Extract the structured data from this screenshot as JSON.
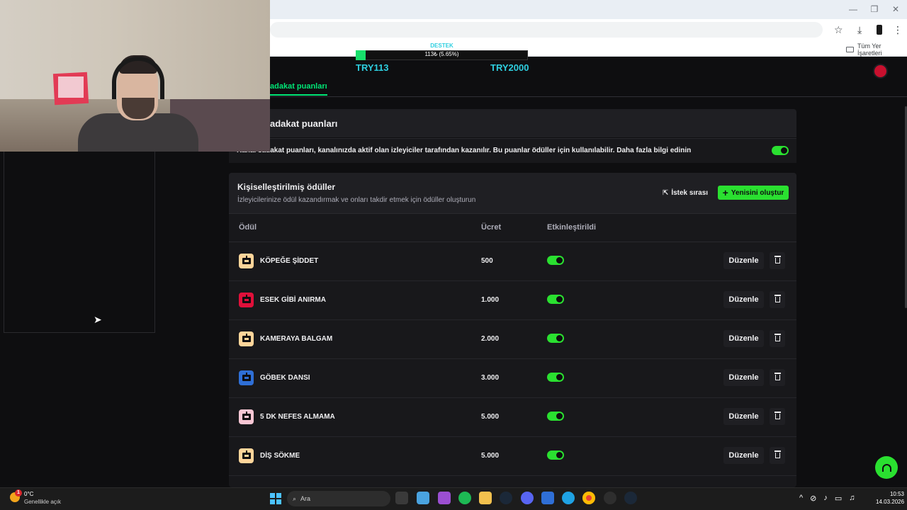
{
  "browser": {
    "bookmarks_folder": "Tüm Yer İşaretleri"
  },
  "donation": {
    "label": "DESTEK",
    "progress_text": "113₺ (5.65%)",
    "progress_fraction": 0.0565,
    "min_label": "TRY113",
    "max_label": "TRY2000",
    "accent": "#2ecfe0",
    "fill_color": "#17e06b"
  },
  "nav": {
    "active_tab": "adakat puanları"
  },
  "loyalty": {
    "title": "adakat puanları",
    "description": "Kanal sadakat puanları, kanalınızda aktif olan izleyiciler tarafından kazanılır. Bu puanlar ödüller için kullanılabilir. Daha fazla bilgi edinin",
    "enabled": true
  },
  "rewards": {
    "title": "Kişiselleştirilmiş ödüller",
    "subtitle": "İzleyicilerinize ödül kazandırmak ve onları takdir etmek için ödüller oluşturun",
    "queue_label": "İstek sırası",
    "new_label": "Yenisini oluştur",
    "columns": {
      "reward": "Ödül",
      "cost": "Ücret",
      "enabled": "Etkinleştirildi"
    },
    "edit_label": "Düzenle",
    "items": [
      {
        "name": "KÖPEĞE ŞİDDET",
        "cost": "500",
        "enabled": true,
        "color": "#ffd59a"
      },
      {
        "name": "ESEK GİBİ ANIRMA",
        "cost": "1.000",
        "enabled": true,
        "color": "#e0103a"
      },
      {
        "name": "KAMERAYA BALGAM",
        "cost": "2.000",
        "enabled": true,
        "color": "#ffd59a"
      },
      {
        "name": "GÖBEK DANSI",
        "cost": "3.000",
        "enabled": true,
        "color": "#2f6fd6"
      },
      {
        "name": "5 DK NEFES ALMAMA",
        "cost": "5.000",
        "enabled": true,
        "color": "#f8c6d4"
      },
      {
        "name": "DİŞ SÖKME",
        "cost": "5.000",
        "enabled": true,
        "color": "#ffd59a"
      }
    ]
  },
  "colors": {
    "brand_green": "#2ae030",
    "background": "#0e0e10",
    "panel": "#18181b"
  },
  "taskbar": {
    "weather_temp": "0°C",
    "weather_desc": "Genellikle açık",
    "weather_badge": "1",
    "search_placeholder": "Ara",
    "time": "10:53",
    "date": "14.03.2026"
  }
}
